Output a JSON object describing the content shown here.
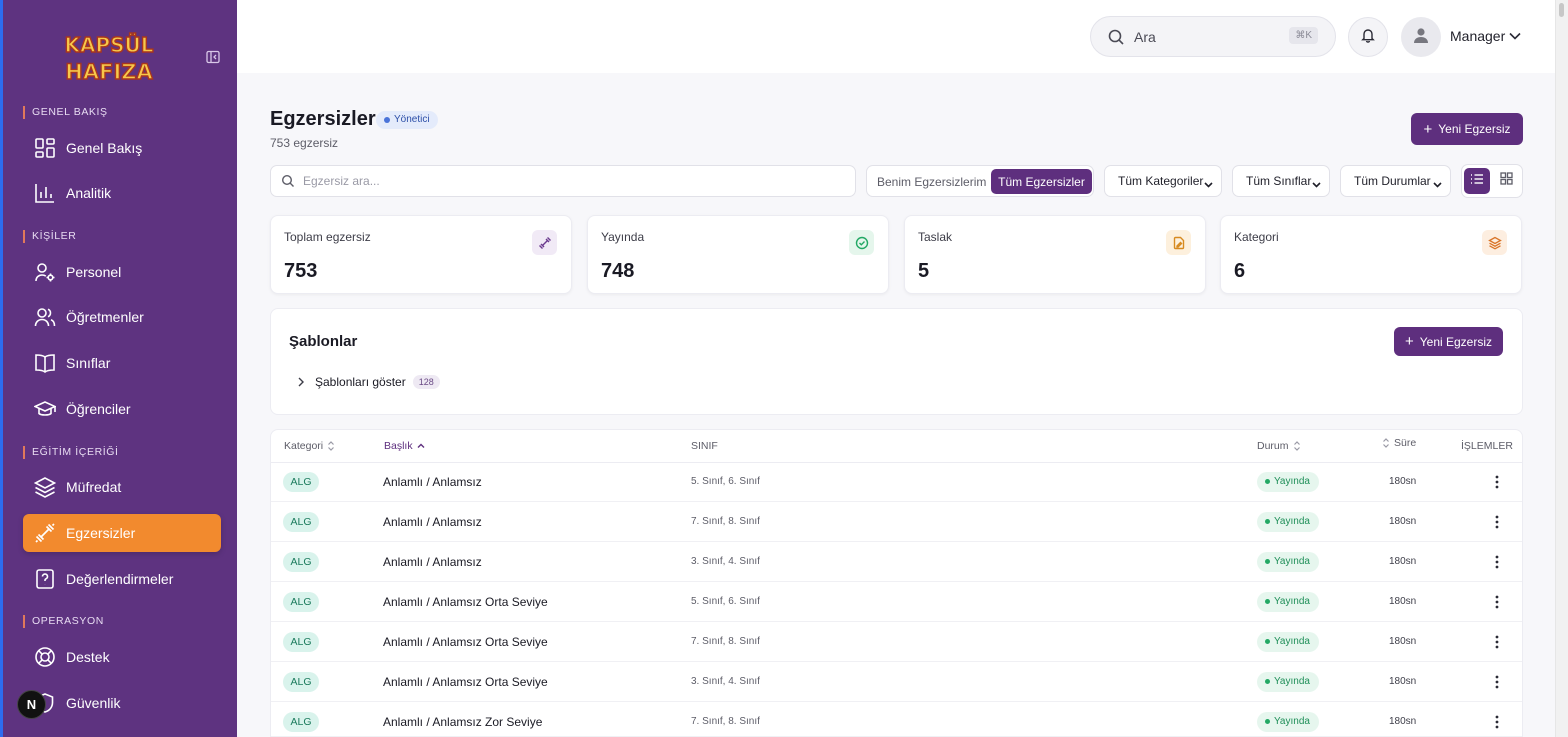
{
  "brand": {
    "logo_line1": "KAPSÜL",
    "logo_line2": "HAFIZA"
  },
  "sidebar": {
    "sections": {
      "overview": "GENEL BAKIŞ",
      "people": "KİŞİLER",
      "content": "EĞİTİM İÇERİĞİ",
      "operations": "OPERASYON"
    },
    "items": {
      "overview": "Genel Bakış",
      "analytics": "Analitik",
      "staff": "Personel",
      "teachers": "Öğretmenler",
      "classes": "Sınıflar",
      "students": "Öğrenciler",
      "curriculum": "Müfredat",
      "exercises": "Egzersizler",
      "assessments": "Değerlendirmeler",
      "support": "Destek",
      "security": "Güvenlik"
    },
    "dev_badge": "N"
  },
  "header": {
    "search_label": "Ara",
    "search_shortcut": "⌘K",
    "user_name": "Manager"
  },
  "page": {
    "title": "Egzersizler",
    "role_badge": "Yönetici",
    "subtitle": "753 egzersiz",
    "new_button": "Yeni Egzersiz"
  },
  "toolbar": {
    "search_placeholder": "Egzersiz ara...",
    "seg_mine": "Benim Egzersizlerim",
    "seg_all": "Tüm Egzersizler",
    "filter_category": "Tüm Kategoriler",
    "filter_class": "Tüm Sınıflar",
    "filter_status": "Tüm Durumlar"
  },
  "stats": [
    {
      "label": "Toplam egzersiz",
      "value": "753"
    },
    {
      "label": "Yayında",
      "value": "748"
    },
    {
      "label": "Taslak",
      "value": "5"
    },
    {
      "label": "Kategori",
      "value": "6"
    }
  ],
  "templates": {
    "title": "Şablonlar",
    "new_button": "Yeni Egzersiz",
    "toggle_label": "Şablonları göster",
    "count": "128"
  },
  "table": {
    "headers": {
      "category": "Kategori",
      "title": "Başlık",
      "class": "SINIF",
      "status": "Durum",
      "duration": "Süre",
      "actions": "İŞLEMLER"
    },
    "rows": [
      {
        "category": "ALG",
        "title": "Anlamlı / Anlamsız",
        "class": "5. Sınıf, 6. Sınıf",
        "status": "Yayında",
        "duration": "180sn"
      },
      {
        "category": "ALG",
        "title": "Anlamlı / Anlamsız",
        "class": "7. Sınıf, 8. Sınıf",
        "status": "Yayında",
        "duration": "180sn"
      },
      {
        "category": "ALG",
        "title": "Anlamlı / Anlamsız",
        "class": "3. Sınıf, 4. Sınıf",
        "status": "Yayında",
        "duration": "180sn"
      },
      {
        "category": "ALG",
        "title": "Anlamlı / Anlamsız Orta Seviye",
        "class": "5. Sınıf, 6. Sınıf",
        "status": "Yayında",
        "duration": "180sn"
      },
      {
        "category": "ALG",
        "title": "Anlamlı / Anlamsız Orta Seviye",
        "class": "7. Sınıf, 8. Sınıf",
        "status": "Yayında",
        "duration": "180sn"
      },
      {
        "category": "ALG",
        "title": "Anlamlı / Anlamsız Orta Seviye",
        "class": "3. Sınıf, 4. Sınıf",
        "status": "Yayında",
        "duration": "180sn"
      },
      {
        "category": "ALG",
        "title": "Anlamlı / Anlamsız Zor Seviye",
        "class": "7. Sınıf, 8. Sınıf",
        "status": "Yayında",
        "duration": "180sn"
      }
    ]
  },
  "colors": {
    "sidebar_bg": "#5e3380",
    "accent_purple": "#5e2f7e",
    "active_orange": "#f28a2e",
    "status_green": "#22a864"
  }
}
